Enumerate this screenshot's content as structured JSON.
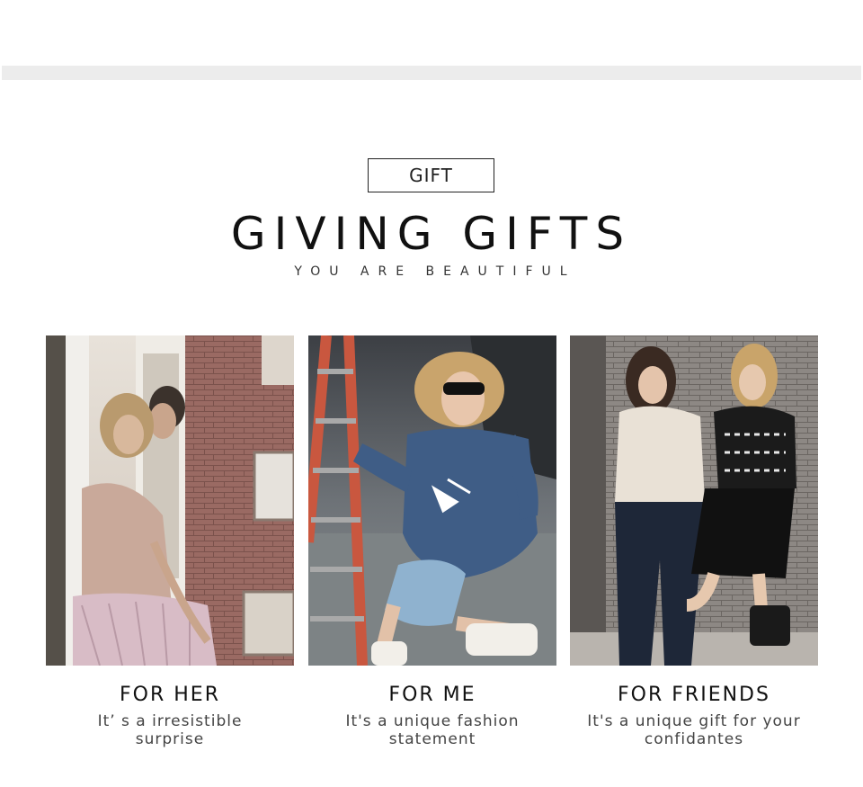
{
  "tag": "GIFT",
  "headline": "GIVING GIFTS",
  "tagline": "YOU ARE BEAUTIFUL",
  "cards": [
    {
      "title": "FOR HER",
      "description": "It’ s a irresistible surprise"
    },
    {
      "title": "FOR ME",
      "description": "It's a unique fashion statement"
    },
    {
      "title": "FOR FRIENDS",
      "description": "It's a unique gift for your confidantes"
    }
  ],
  "colors": {
    "background": "#ffffff",
    "band": "#ececec",
    "text": "#111111"
  }
}
